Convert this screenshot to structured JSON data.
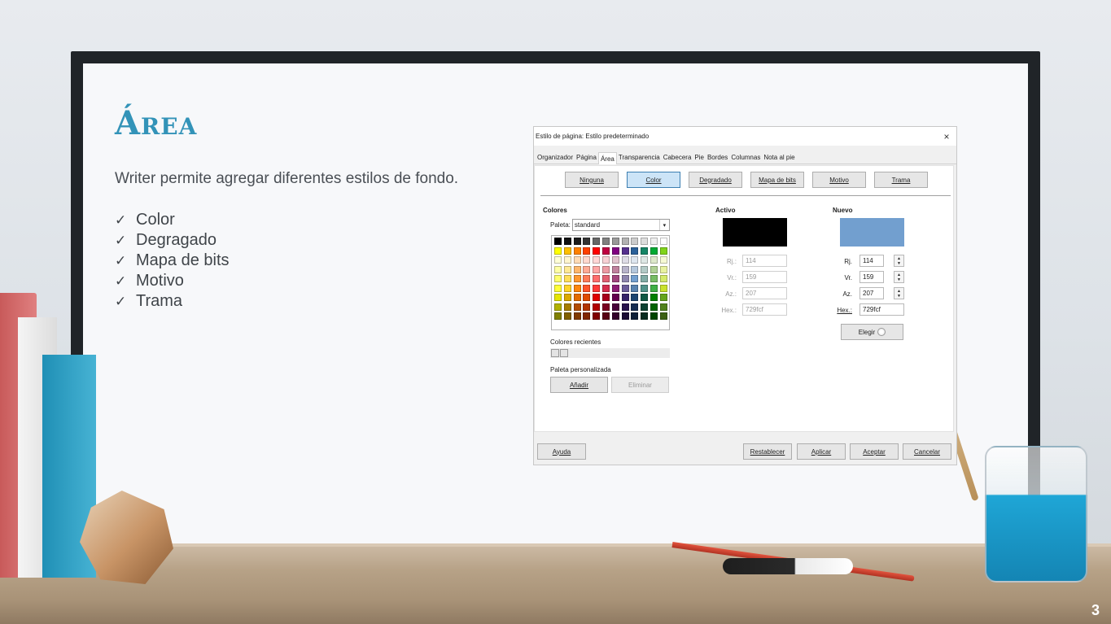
{
  "slide": {
    "title": "Área",
    "subtitle": "Writer permite agregar diferentes estilos de fondo.",
    "bullets": [
      "Color",
      "Degragado",
      "Mapa de bits",
      "Motivo",
      "Trama"
    ],
    "check_glyph": "✓",
    "page_number": "3"
  },
  "dialog": {
    "title": "Estilo de página: Estilo predeterminado",
    "close_glyph": "×",
    "tabs": [
      "Organizador",
      "Página",
      "Área",
      "Transparencia",
      "Cabecera",
      "Pie",
      "Bordes",
      "Columnas",
      "Nota al pie"
    ],
    "active_tab": "Área",
    "fill_buttons": [
      "Ninguna",
      "Color",
      "Degradado",
      "Mapa de bits",
      "Motivo",
      "Trama"
    ],
    "active_fill": "Color",
    "colores_label": "Colores",
    "paleta_label": "Paleta:",
    "paleta_value": "standard",
    "recent_label": "Colores recientes",
    "custom_label": "Paleta personalizada",
    "add_label": "Añadir",
    "delete_label": "Eliminar",
    "active_label": "Activo",
    "new_label": "Nuevo",
    "active_color": "#000000",
    "new_color": "#729fcf",
    "active_fields": {
      "r_label": "Rj.:",
      "r_value": "114",
      "g_label": "Vr.:",
      "g_value": "159",
      "b_label": "Az.:",
      "b_value": "207",
      "hex_label": "Hex.:",
      "hex_value": "729fcf"
    },
    "new_fields": {
      "r_label": "Rj.",
      "r_value": "114",
      "g_label": "Vr.",
      "g_value": "159",
      "b_label": "Az.",
      "b_value": "207",
      "hex_label": "Hex.:",
      "hex_value": "729fcf"
    },
    "pick_label": "Elegir",
    "bottom": {
      "help": "Ayuda",
      "reset": "Restablecer",
      "apply": "Aplicar",
      "ok": "Aceptar",
      "cancel": "Cancelar"
    }
  },
  "palette_colors": [
    "#000000",
    "#111111",
    "#1c1c1c",
    "#333333",
    "#666666",
    "#808080",
    "#999999",
    "#b2b2b2",
    "#cccccc",
    "#dddddd",
    "#eeeeee",
    "#ffffff",
    "#ffff00",
    "#ffbf00",
    "#ff8000",
    "#ff4000",
    "#ff0000",
    "#bf0041",
    "#800080",
    "#55308d",
    "#2a6099",
    "#158466",
    "#00a933",
    "#81d41a",
    "#ffffd7",
    "#fff5ce",
    "#ffdbb6",
    "#ffd8ce",
    "#ffd7d7",
    "#f7d1d5",
    "#e0c2cd",
    "#dedce6",
    "#dee6ef",
    "#dee7e5",
    "#dde8cb",
    "#f6f9d4",
    "#ffffa6",
    "#ffe994",
    "#ffb66c",
    "#ffaa95",
    "#ffa6a6",
    "#ec9ba4",
    "#bf819e",
    "#b7b3ca",
    "#b4c7dc",
    "#b3cac7",
    "#afd095",
    "#e8f2a1",
    "#ffff6d",
    "#ffde59",
    "#ff972f",
    "#ff7b59",
    "#ff6d6d",
    "#e16173",
    "#a1467e",
    "#8e86ae",
    "#729fcf",
    "#81aca6",
    "#77bc65",
    "#d4ea6b",
    "#ffff38",
    "#ffd428",
    "#ff860d",
    "#ff5429",
    "#ff3838",
    "#d62e4e",
    "#8d1d75",
    "#6b5e9b",
    "#5983b0",
    "#50938a",
    "#3faf46",
    "#c9e22d",
    "#e6e600",
    "#dcaa00",
    "#e46c00",
    "#e04b00",
    "#e00000",
    "#a8001c",
    "#63004e",
    "#352369",
    "#1b4471",
    "#0f5944",
    "#008000",
    "#65a51c",
    "#b2b200",
    "#a67d00",
    "#b24c00",
    "#b23400",
    "#b20000",
    "#7b0021",
    "#48003a",
    "#27124d",
    "#142c52",
    "#0c4232",
    "#006400",
    "#50821b",
    "#808000",
    "#806000",
    "#803a00",
    "#802600",
    "#800000",
    "#590015",
    "#33002b",
    "#1a0c34",
    "#0d1f38",
    "#082b20",
    "#004600",
    "#3c6013"
  ]
}
